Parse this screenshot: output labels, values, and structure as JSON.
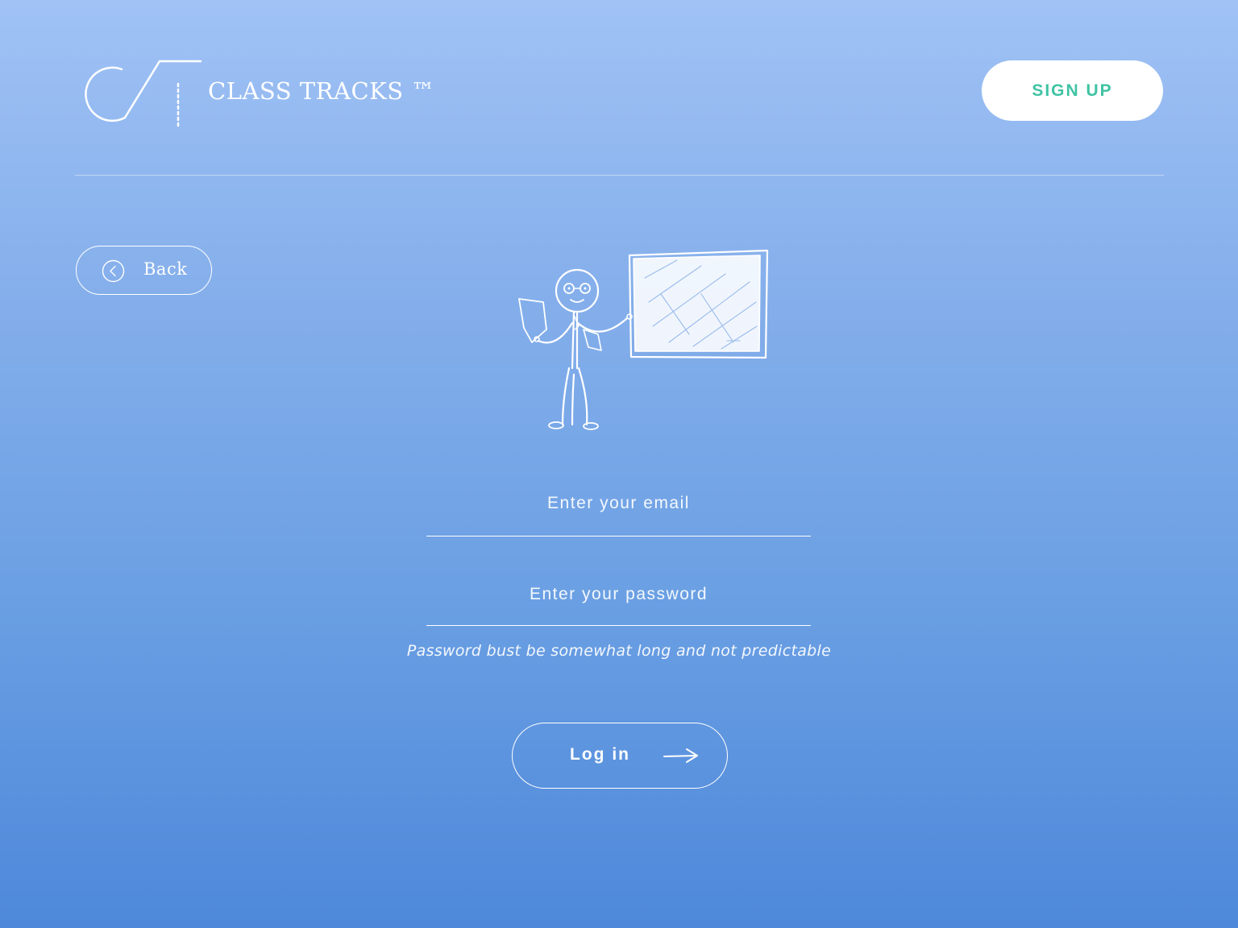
{
  "header": {
    "brand_name": "CLASS TRACKS ™",
    "logo_icon": "ct-logo-icon",
    "signup_label": "SIGN UP"
  },
  "nav": {
    "back_label": "Back",
    "back_icon": "chevron-left-circle-icon"
  },
  "illustration": {
    "icon": "teacher-blackboard-illustration"
  },
  "form": {
    "email_placeholder": "Enter your email",
    "password_placeholder": "Enter your password",
    "password_hint": "Password bust be somewhat long and not predictable",
    "login_label": "Log in",
    "login_icon": "arrow-right-icon"
  },
  "colors": {
    "background_top": "#a0c2f5",
    "background_bottom": "#4e88da",
    "accent": "#3fc3a3",
    "foreground": "#ffffff"
  }
}
